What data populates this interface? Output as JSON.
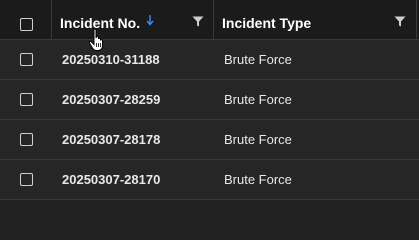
{
  "header": {
    "incident_no_label": "Incident No.",
    "incident_type_label": "Incident Type",
    "sort_direction": "ascending",
    "sort_color": "#3d8bfd"
  },
  "rows": [
    {
      "incident_no": "20250310-31188",
      "incident_type": "Brute Force"
    },
    {
      "incident_no": "20250307-28259",
      "incident_type": "Brute Force"
    },
    {
      "incident_no": "20250307-28178",
      "incident_type": "Brute Force"
    },
    {
      "incident_no": "20250307-28170",
      "incident_type": "Brute Force"
    }
  ],
  "icons": {
    "sort": "sort-ascending-icon",
    "filter": "filter-icon",
    "cursor": "hand-pointer-cursor-icon"
  }
}
